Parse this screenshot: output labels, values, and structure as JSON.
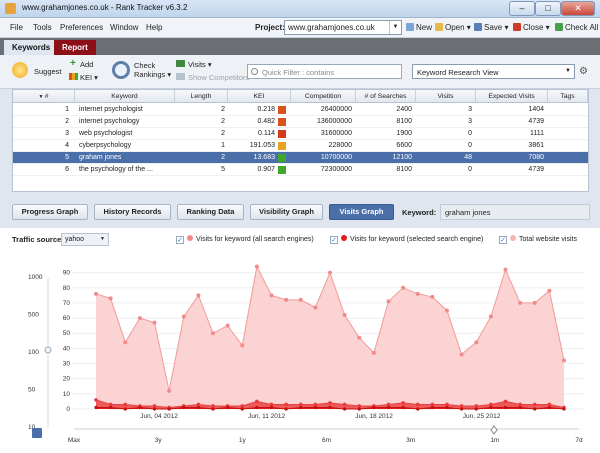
{
  "window": {
    "title": "www.grahamjones.co.uk - Rank Tracker v6.3.2",
    "min": "–",
    "max": "□",
    "close": "✕"
  },
  "menu": {
    "file": "File",
    "tools": "Tools",
    "preferences": "Preferences",
    "window": "Window",
    "help": "Help"
  },
  "project": {
    "label": "Project:",
    "value": "www.grahamjones.co.uk"
  },
  "toolbar_top": {
    "new": "New",
    "open": "Open",
    "save": "Save",
    "close": "Close",
    "check_all": "Check All"
  },
  "tabs": [
    {
      "label": "Keywords"
    },
    {
      "label": "Report"
    }
  ],
  "toolbar": {
    "suggest": "Suggest",
    "add": "Add",
    "kei": "KEI",
    "check_rankings_1": "Check",
    "check_rankings_2": "Rankings",
    "visits": "Visits",
    "show_competitors": "Show Competitors",
    "quick_filter": "Quick Filter : contains",
    "view": "Keyword Research View"
  },
  "table": {
    "headers": [
      "#",
      "Keyword",
      "Length",
      "KEI",
      "Competition",
      "# of Searches",
      "Visits",
      "Expected Visits",
      "Tags"
    ],
    "rows": [
      {
        "num": "1",
        "keyword": "internet psychologist",
        "length": "2",
        "kei": "0.218",
        "kei_color": "#d9531e",
        "competition": "26400000",
        "searches": "2400",
        "visits": "3",
        "expected": "1404",
        "selected": false
      },
      {
        "num": "2",
        "keyword": "internet psychology",
        "length": "2",
        "kei": "0.482",
        "kei_color": "#d9531e",
        "competition": "136000000",
        "searches": "8100",
        "visits": "3",
        "expected": "4739",
        "selected": false
      },
      {
        "num": "3",
        "keyword": "web psychologist",
        "length": "2",
        "kei": "0.114",
        "kei_color": "#d23b1c",
        "competition": "31600000",
        "searches": "1900",
        "visits": "0",
        "expected": "1111",
        "selected": false
      },
      {
        "num": "4",
        "keyword": "cyberpsychology",
        "length": "1",
        "kei": "191.053",
        "kei_color": "#e8a21f",
        "competition": "228000",
        "searches": "6600",
        "visits": "0",
        "expected": "3861",
        "selected": false
      },
      {
        "num": "5",
        "keyword": "graham jones",
        "length": "2",
        "kei": "13.683",
        "kei_color": "#3fa82c",
        "competition": "10700000",
        "searches": "12100",
        "visits": "48",
        "expected": "7080",
        "selected": true
      },
      {
        "num": "6",
        "keyword": "the psychology of the ...",
        "length": "5",
        "kei": "0.907",
        "kei_color": "#3fa82c",
        "competition": "72300000",
        "searches": "8100",
        "visits": "0",
        "expected": "4739",
        "selected": false
      }
    ]
  },
  "graph_tabs": [
    "Progress Graph",
    "History Records",
    "Ranking Data",
    "Visibility Graph",
    "Visits Graph"
  ],
  "keyword_label": "Keyword:",
  "keyword_value": "graham jones",
  "traffic": {
    "label": "Traffic source:",
    "value": "yahoo"
  },
  "legend": [
    {
      "label": "Visits for keyword (all search engines)",
      "color": "#f28a8a"
    },
    {
      "label": "Visits for keyword (selected search engine)",
      "color": "#e21b1b"
    },
    {
      "label": "Total website visits",
      "color": "#f7b3b3"
    }
  ],
  "colors": {
    "accent": "#4a6fa9",
    "report_tab": "#8c0f18",
    "area_fill": "#fbd2d2",
    "area_line": "#f48a8a",
    "low_fill": "#e63030"
  },
  "chart_data": {
    "type": "area",
    "left_axis_ticks": [
      "1000",
      "500",
      "100",
      "50",
      "10"
    ],
    "y_ticks": [
      "90",
      "80",
      "70",
      "60",
      "50",
      "40",
      "30",
      "20",
      "10",
      "0"
    ],
    "ylim": [
      0,
      97
    ],
    "x_labels": [
      "Jun, 04 2012",
      "Jun, 11 2012",
      "Jun, 18 2012",
      "Jun, 25 2012"
    ],
    "timeline_labels": [
      "Max",
      "3y",
      "1y",
      "6m",
      "3m",
      "1m",
      "7d"
    ],
    "series": [
      {
        "name": "Total website visits",
        "values": [
          76,
          73,
          44,
          60,
          57,
          12,
          61,
          75,
          50,
          55,
          42,
          94,
          75,
          72,
          72,
          67,
          90,
          62,
          47,
          37,
          71,
          80,
          76,
          74,
          65,
          36,
          44,
          61,
          92,
          70,
          70,
          78,
          32
        ]
      },
      {
        "name": "Visits for keyword (all search engines)",
        "values": [
          6,
          3,
          3,
          2,
          2,
          1,
          2,
          3,
          2,
          2,
          2,
          5,
          3,
          3,
          3,
          3,
          4,
          3,
          2,
          2,
          3,
          4,
          3,
          3,
          3,
          2,
          2,
          3,
          5,
          3,
          3,
          3,
          1
        ]
      },
      {
        "name": "Visits for keyword (selected search engine)",
        "values": [
          1,
          1,
          0,
          1,
          0,
          0,
          1,
          1,
          0,
          1,
          0,
          1,
          1,
          0,
          1,
          1,
          1,
          0,
          0,
          1,
          1,
          1,
          0,
          1,
          1,
          0,
          0,
          1,
          1,
          1,
          0,
          1,
          0
        ]
      }
    ]
  }
}
